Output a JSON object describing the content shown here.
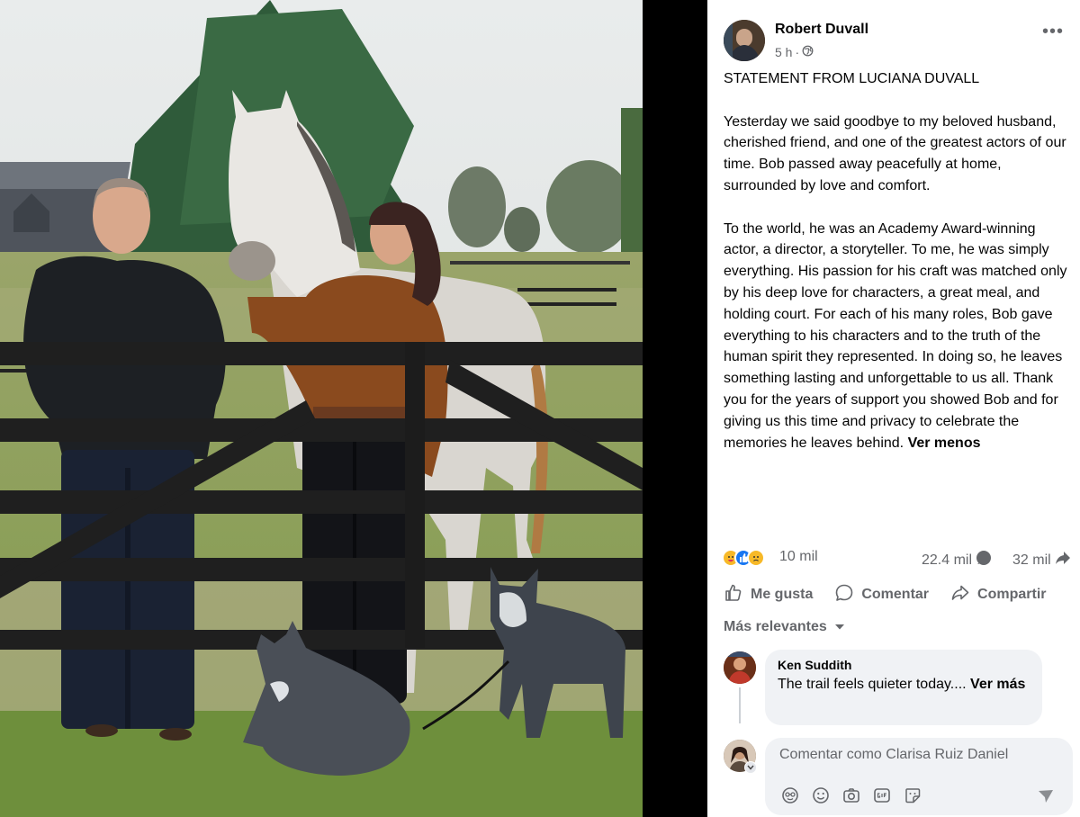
{
  "post": {
    "author": "Robert Duvall",
    "time": "5 h",
    "separator": "·",
    "more_label": "•••",
    "paragraphs": [
      "STATEMENT FROM LUCIANA DUVALL",
      "Yesterday we said goodbye to my beloved husband, cherished friend, and one of the greatest actors of our time. Bob passed away peacefully at home, surrounded by love and comfort.",
      "To the world, he was an Academy Award-winning actor, a director, a storyteller. To me, he was simply everything. His passion for his craft was matched only by his deep love for characters, a great meal, and holding court. For each of his many roles, Bob gave everything to his characters and to the truth of the human spirit they represented. In doing so, he leaves something lasting and unforgettable to us all. Thank you for the years of support you showed Bob and for giving us this time and privacy to celebrate the memories he leaves behind."
    ],
    "see_less": "Ver menos"
  },
  "stats": {
    "reactions": "10 mil",
    "comments": "22.4 mil",
    "shares": "32 mil",
    "reaction_icons": [
      "care",
      "like",
      "sad"
    ]
  },
  "actions": {
    "like": "Me gusta",
    "comment": "Comentar",
    "share": "Compartir"
  },
  "sort_label": "Más relevantes",
  "comment": {
    "author": "Ken Suddith",
    "text": "The trail feels quieter today....",
    "see_more": "Ver más"
  },
  "composer": {
    "placeholder": "Comentar como Clarisa Ruiz Daniel",
    "tools": [
      "avatar-sticker-icon",
      "emoji-icon",
      "camera-icon",
      "gif-icon",
      "sticker-icon"
    ]
  },
  "colors": {
    "text": "#050505",
    "secondary": "#65676b",
    "bubble": "#f0f2f5",
    "like_blue": "#1877f2"
  }
}
